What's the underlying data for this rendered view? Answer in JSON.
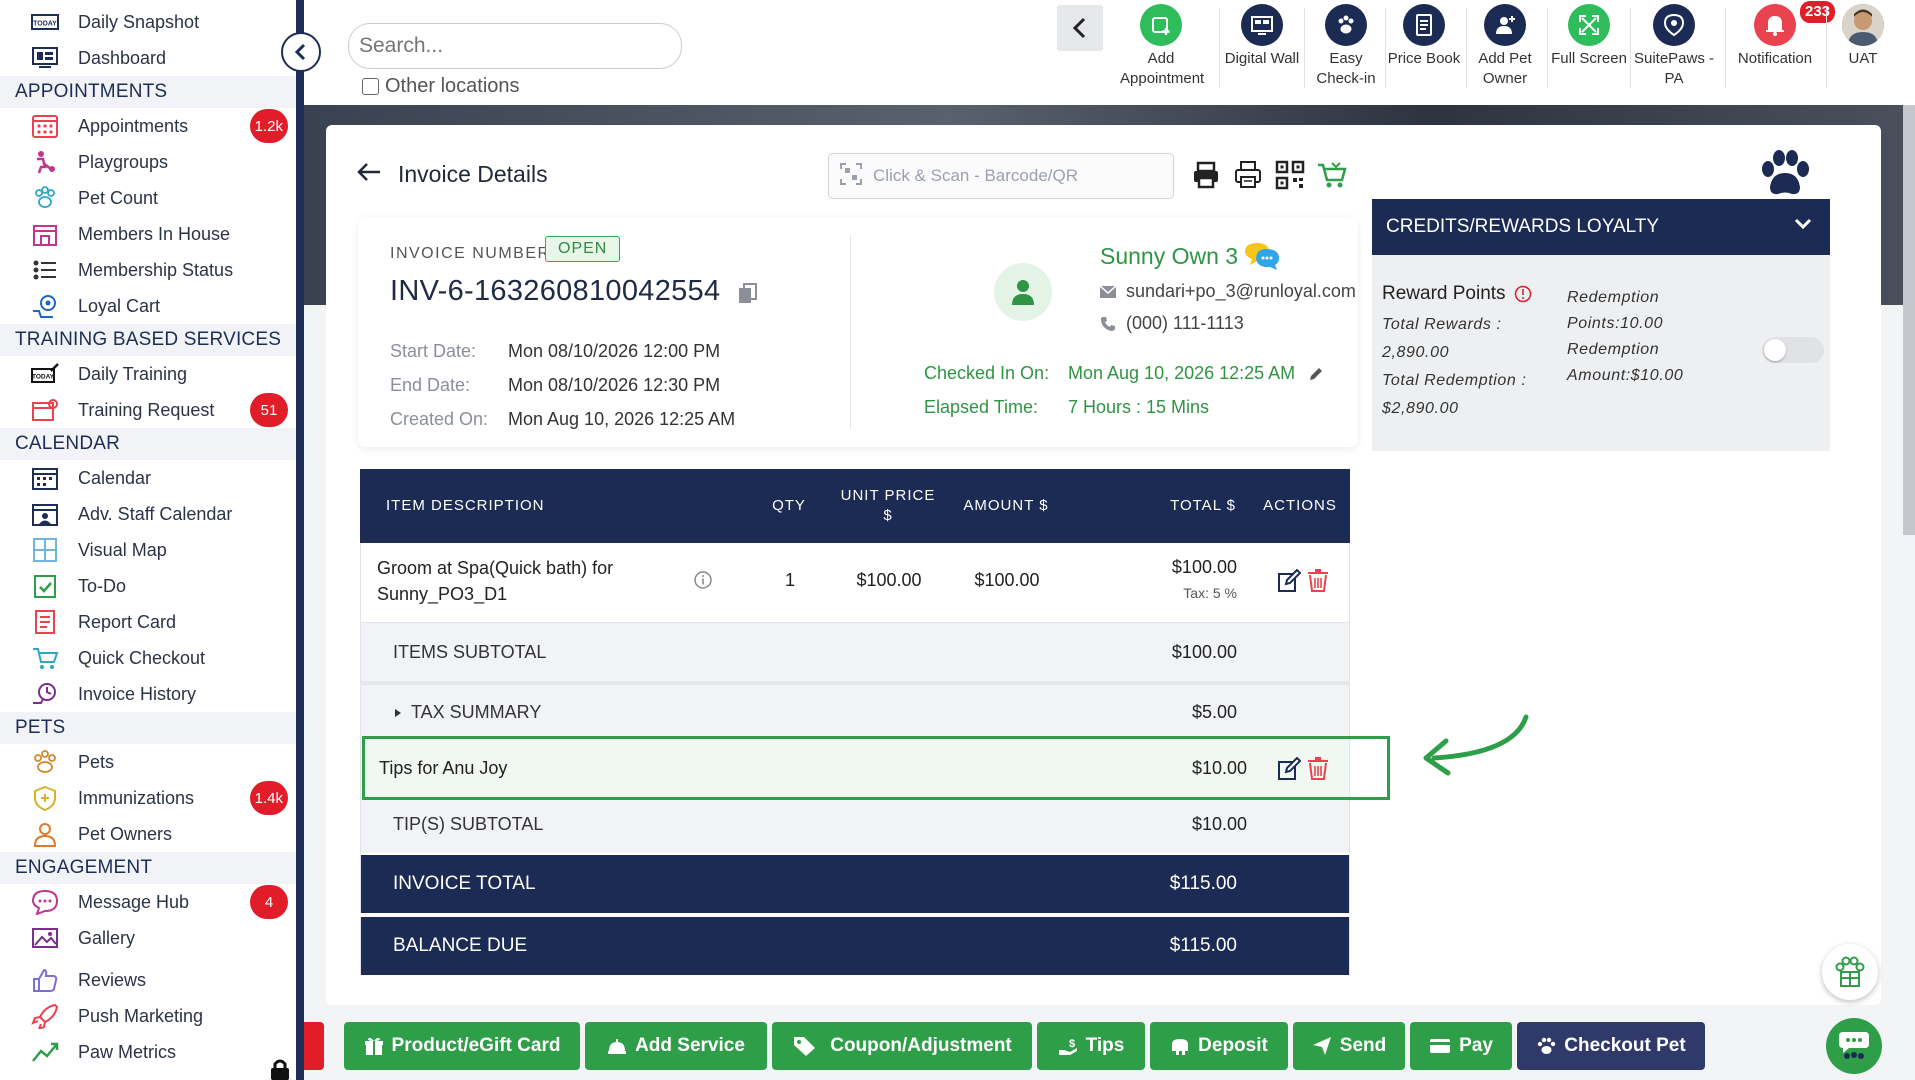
{
  "sidebar": {
    "top_items": [
      {
        "label": "Daily Snapshot",
        "icon": "today-icon"
      },
      {
        "label": "Dashboard",
        "icon": "dashboard-icon"
      }
    ],
    "sections": [
      {
        "title": "APPOINTMENTS",
        "items": [
          {
            "label": "Appointments",
            "icon": "calendar-grid-icon",
            "badge": "1.2k"
          },
          {
            "label": "Playgroups",
            "icon": "playgroup-icon"
          },
          {
            "label": "Pet Count",
            "icon": "paw-icon"
          },
          {
            "label": "Members In House",
            "icon": "house-icon"
          },
          {
            "label": "Membership Status",
            "icon": "list-status-icon"
          },
          {
            "label": "Loyal Cart",
            "icon": "loyal-cart-icon"
          }
        ]
      },
      {
        "title": "TRAINING BASED SERVICES",
        "items": [
          {
            "label": "Daily Training",
            "icon": "today-training-icon"
          },
          {
            "label": "Training Request",
            "icon": "training-request-icon",
            "badge": "51"
          }
        ]
      },
      {
        "title": "CALENDAR",
        "items": [
          {
            "label": "Calendar",
            "icon": "calendar-icon"
          },
          {
            "label": "Adv. Staff Calendar",
            "icon": "staff-calendar-icon"
          },
          {
            "label": "Visual Map",
            "icon": "map-grid-icon"
          },
          {
            "label": "To-Do",
            "icon": "todo-icon"
          },
          {
            "label": "Report Card",
            "icon": "report-card-icon"
          },
          {
            "label": "Quick Checkout",
            "icon": "cart-icon"
          },
          {
            "label": "Invoice History",
            "icon": "invoice-history-icon"
          }
        ]
      },
      {
        "title": "PETS",
        "items": [
          {
            "label": "Pets",
            "icon": "paw-icon"
          },
          {
            "label": "Immunizations",
            "icon": "shield-icon",
            "badge": "1.4k"
          },
          {
            "label": "Pet Owners",
            "icon": "person-icon"
          }
        ]
      },
      {
        "title": "ENGAGEMENT",
        "items": [
          {
            "label": "Message Hub",
            "icon": "message-icon",
            "badge": "4"
          },
          {
            "label": "Gallery",
            "icon": "gallery-icon"
          },
          {
            "label": "Reviews",
            "icon": "thumbs-up-icon"
          },
          {
            "label": "Push Marketing",
            "icon": "rocket-icon"
          },
          {
            "label": "Paw Metrics",
            "icon": "metrics-icon"
          }
        ]
      }
    ]
  },
  "topbar": {
    "search_placeholder": "Search...",
    "other_locations": "Other locations",
    "items": [
      {
        "label": "Add Appointment",
        "icon": "add-appointment-icon",
        "color": "#2ebd5a"
      },
      {
        "label": "Digital Wall",
        "icon": "digital-wall-icon",
        "color": "#1c2b53"
      },
      {
        "label": "Easy Check-in",
        "icon": "easy-checkin-icon",
        "color": "#1c2b53"
      },
      {
        "label": "Price Book",
        "icon": "price-book-icon",
        "color": "#1c2b53"
      },
      {
        "label": "Add Pet Owner",
        "icon": "add-pet-owner-icon",
        "color": "#1c2b53"
      },
      {
        "label": "Full Screen",
        "icon": "full-screen-icon",
        "color": "#2ebd5a"
      },
      {
        "label": "SuitePaws - PA",
        "icon": "suitepaws-icon",
        "color": "#1c2b53"
      },
      {
        "label": "Notification",
        "icon": "bell-icon",
        "color": "#e11d2a",
        "badge": "233"
      },
      {
        "label": "UAT",
        "icon": "user-avatar-icon",
        "color": "#8b6a4e"
      }
    ]
  },
  "invoice": {
    "header_title": "Invoice Details",
    "scan_placeholder": "Click & Scan - Barcode/QR",
    "number_label": "INVOICE NUMBER",
    "status": "OPEN",
    "number": "INV-6-163260810042554",
    "dates": [
      {
        "label": "Start Date:",
        "value": "Mon 08/10/2026 12:00 PM"
      },
      {
        "label": "End Date:",
        "value": "Mon 08/10/2026 12:30 PM"
      },
      {
        "label": "Created On:",
        "value": "Mon Aug 10, 2026 12:25 AM"
      }
    ],
    "owner": {
      "name": "Sunny Own 3",
      "email": "sundari+po_3@runloyal.com",
      "phone": "(000) 111-1113",
      "checked_in_label": "Checked In On:",
      "checked_in_value": "Mon Aug 10, 2026 12:25 AM",
      "elapsed_label": "Elapsed Time:",
      "elapsed_value": "7 Hours : 15 Mins"
    },
    "table": {
      "headers": {
        "description": "ITEM DESCRIPTION",
        "qty": "QTY",
        "unit_price": "UNIT PRICE $",
        "amount": "AMOUNT $",
        "total": "TOTAL $",
        "actions": "ACTIONS"
      },
      "items": [
        {
          "description": "Groom at Spa(Quick bath) for Sunny_PO3_D1",
          "qty": "1",
          "unit_price": "$100.00",
          "amount": "$100.00",
          "total": "$100.00",
          "tax": "Tax: 5 %"
        }
      ],
      "items_subtotal_label": "ITEMS SUBTOTAL",
      "items_subtotal": "$100.00",
      "tax_summary_label": "TAX SUMMARY",
      "tax_summary": "$5.00",
      "tip_label": "Tips for Anu Joy",
      "tip_value": "$10.00",
      "tips_subtotal_label": "TIP(S) SUBTOTAL",
      "tips_subtotal": "$10.00",
      "invoice_total_label": "INVOICE TOTAL",
      "invoice_total": "$115.00",
      "balance_due_label": "BALANCE DUE",
      "balance_due": "$115.00"
    }
  },
  "loyalty": {
    "title": "CREDITS/REWARDS LOYALTY",
    "reward_points_label": "Reward Points",
    "total_rewards_label": "Total Rewards :",
    "total_rewards": "2,890.00",
    "total_redemption_label": "Total Redemption :",
    "total_redemption": "$2,890.00",
    "redemption_points": "Redemption Points:10.00",
    "redemption_amount": "Redemption Amount:$10.00"
  },
  "actions": [
    {
      "label": "Product/eGift Card",
      "icon": "gift-icon",
      "color": "#2e9e48"
    },
    {
      "label": "Add Service",
      "icon": "service-bell-icon",
      "color": "#2e9e48"
    },
    {
      "label": "Coupon/Adjustment",
      "icon": "tag-icon",
      "color": "#2e9e48"
    },
    {
      "label": "Tips",
      "icon": "tip-hand-icon",
      "color": "#2e9e48"
    },
    {
      "label": "Deposit",
      "icon": "deposit-icon",
      "color": "#2e9e48"
    },
    {
      "label": "Send",
      "icon": "send-icon",
      "color": "#2e9e48"
    },
    {
      "label": "Pay",
      "icon": "card-icon",
      "color": "#2e9e48"
    },
    {
      "label": "Checkout Pet",
      "icon": "paw-icon",
      "color": "#2f3a6b"
    }
  ]
}
